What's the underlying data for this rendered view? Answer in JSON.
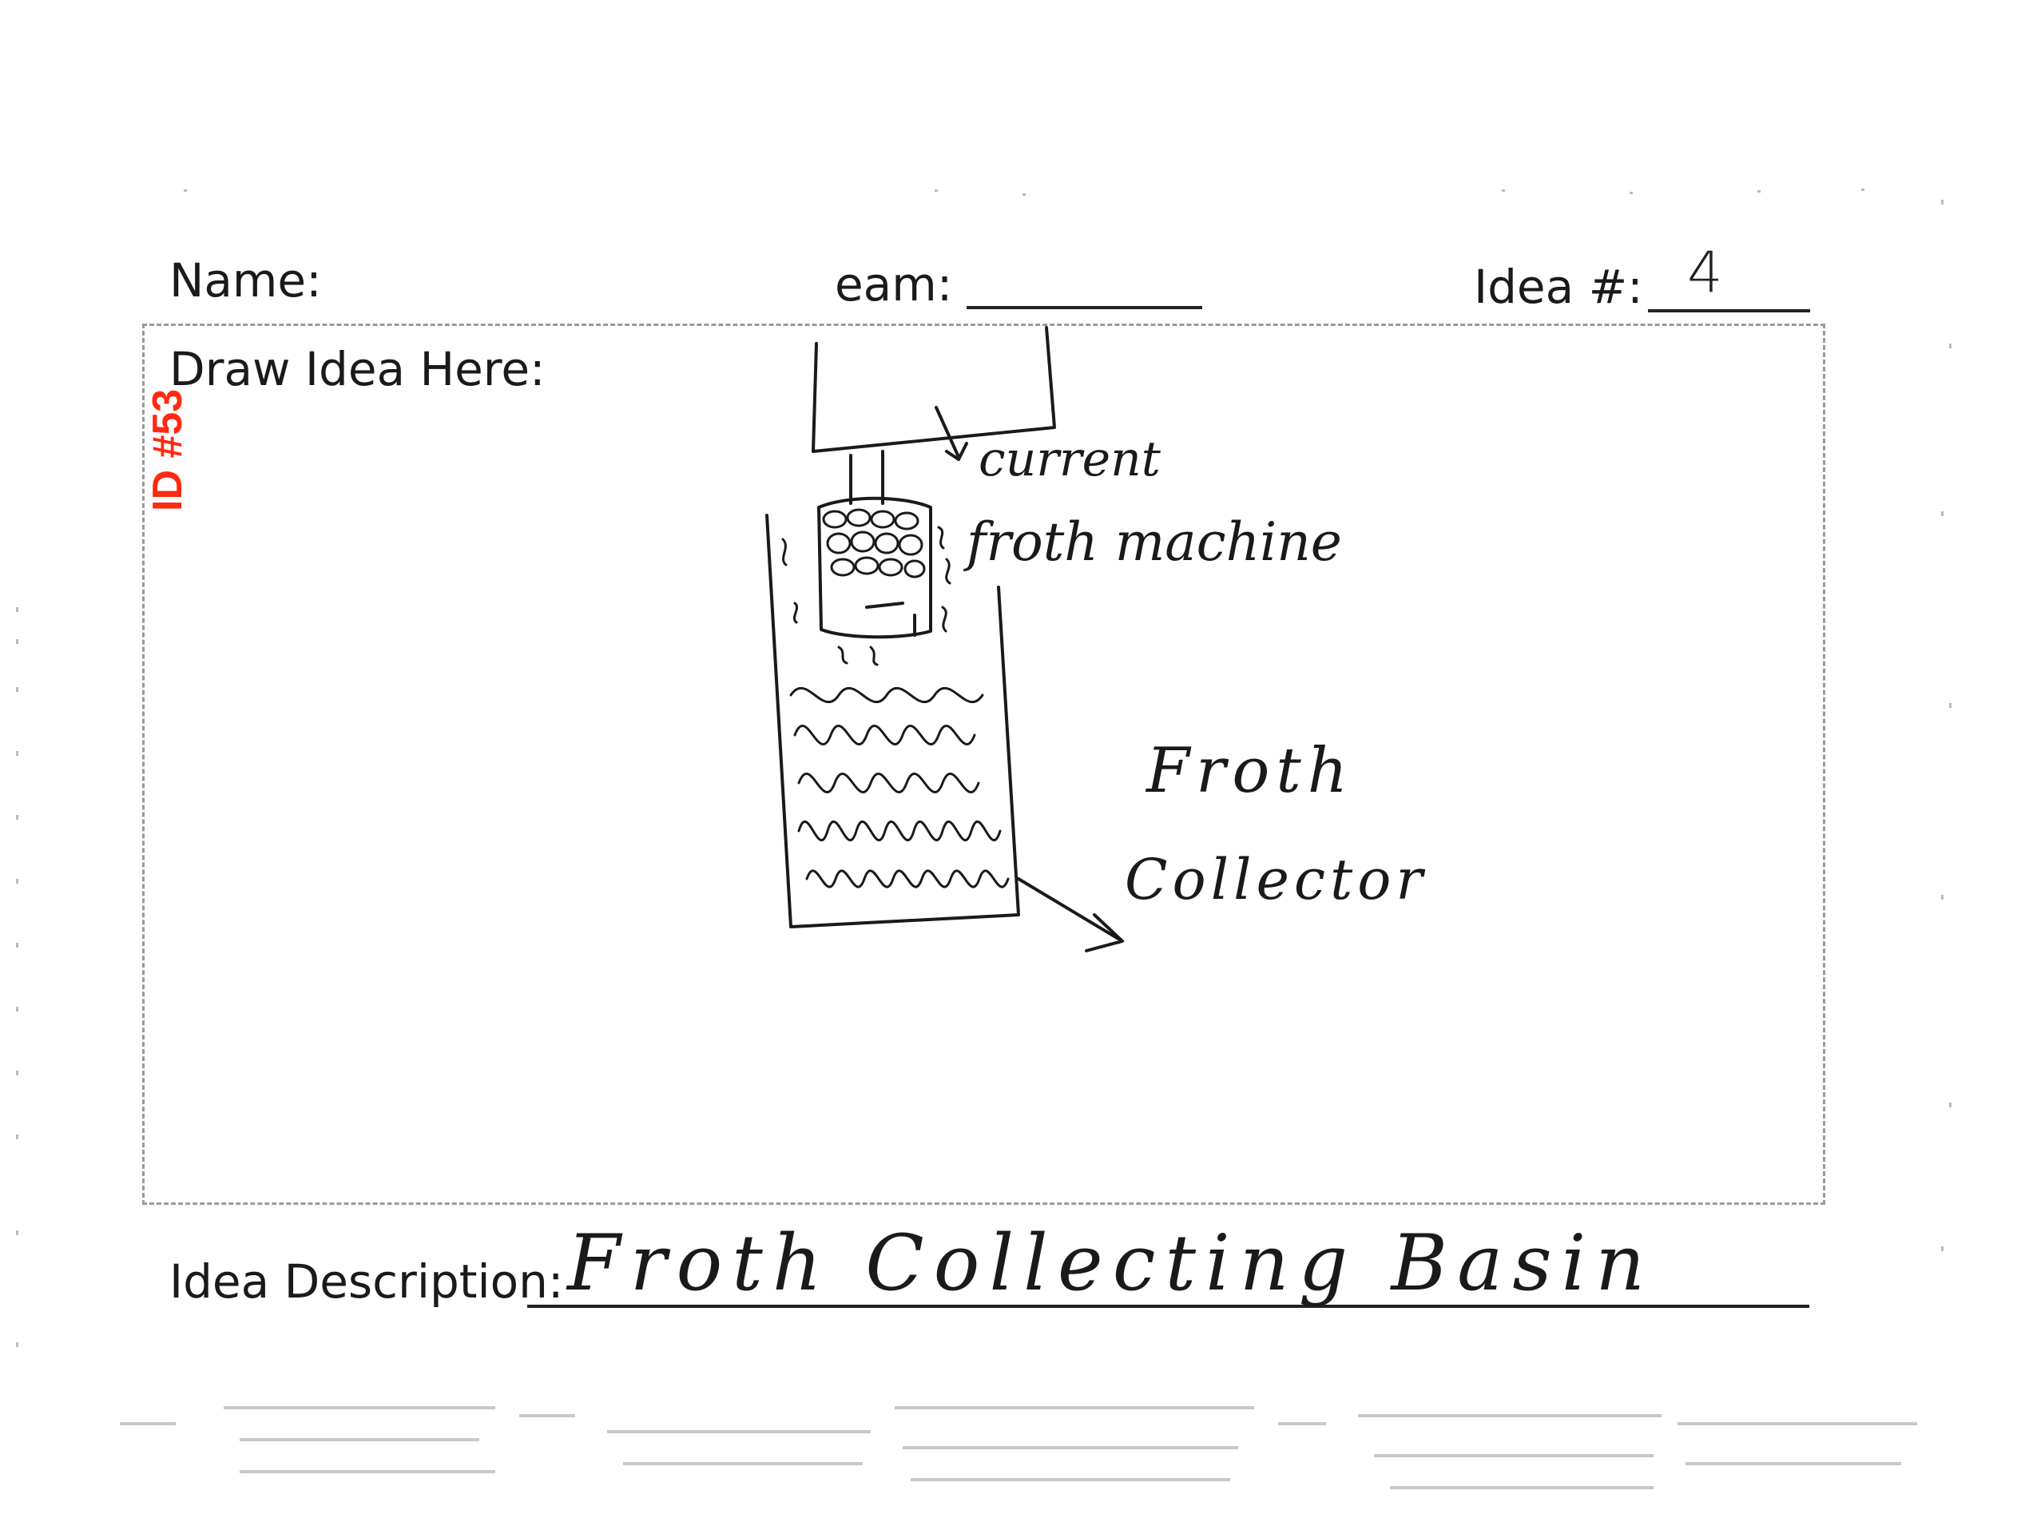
{
  "header": {
    "name_label": "Name:",
    "team_label": "eam:",
    "idea_number_label": "Idea #:",
    "idea_number_value": "4"
  },
  "draw_area": {
    "label": "Draw Idea Here:"
  },
  "stamp": {
    "id_text": "ID #53",
    "color": "#ff2a10"
  },
  "sketch": {
    "annotation_machine_line1": "current",
    "annotation_machine_line2": "froth machine",
    "annotation_collector_line1": "Froth",
    "annotation_collector_line2": "Collector"
  },
  "description": {
    "label": "Idea Description:",
    "value": "Froth Collecting Basin"
  }
}
